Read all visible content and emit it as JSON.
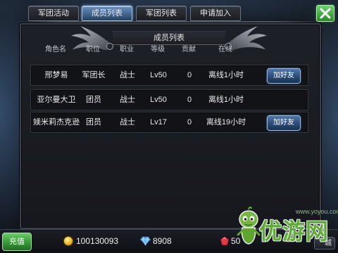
{
  "tabs": [
    {
      "label": "军团活动",
      "selected": false
    },
    {
      "label": "成员列表",
      "selected": true
    },
    {
      "label": "军团列表",
      "selected": false
    },
    {
      "label": "申请加入",
      "selected": false
    }
  ],
  "close_button": {
    "icon": "close-icon"
  },
  "panel": {
    "title": "成员列表"
  },
  "table": {
    "columns": [
      "角色名",
      "职位",
      "职业",
      "等级",
      "贡献",
      "在线"
    ],
    "rows": [
      {
        "name": "邢梦易",
        "position": "军团长",
        "class": "战士",
        "level": "Lv50",
        "contribution": "0",
        "online": "离线1小时",
        "action": "加好友"
      },
      {
        "name": "亚尔曼大卫",
        "position": "团员",
        "class": "战士",
        "level": "Lv50",
        "contribution": "0",
        "online": "离线1小时"
      },
      {
        "name": "媄米莉杰克逊",
        "position": "团员",
        "class": "战士",
        "level": "Lv17",
        "contribution": "0",
        "online": "离线19小时",
        "action": "加好友"
      }
    ]
  },
  "footer": {
    "recharge_label": "充值",
    "gold": {
      "icon": "gold-coin-icon",
      "value": "100130093"
    },
    "diamond": {
      "icon": "diamond-icon",
      "value": "8908"
    },
    "ruby": {
      "icon": "red-gem-icon",
      "value": "50"
    },
    "shop_label": "城"
  },
  "watermark": {
    "name": "优游网",
    "url": "www.yoyou.com"
  },
  "colors": {
    "accent_green": "#3c9c3c",
    "selected_tab": "#4a6e98",
    "button_blue": "#2c4c78"
  }
}
